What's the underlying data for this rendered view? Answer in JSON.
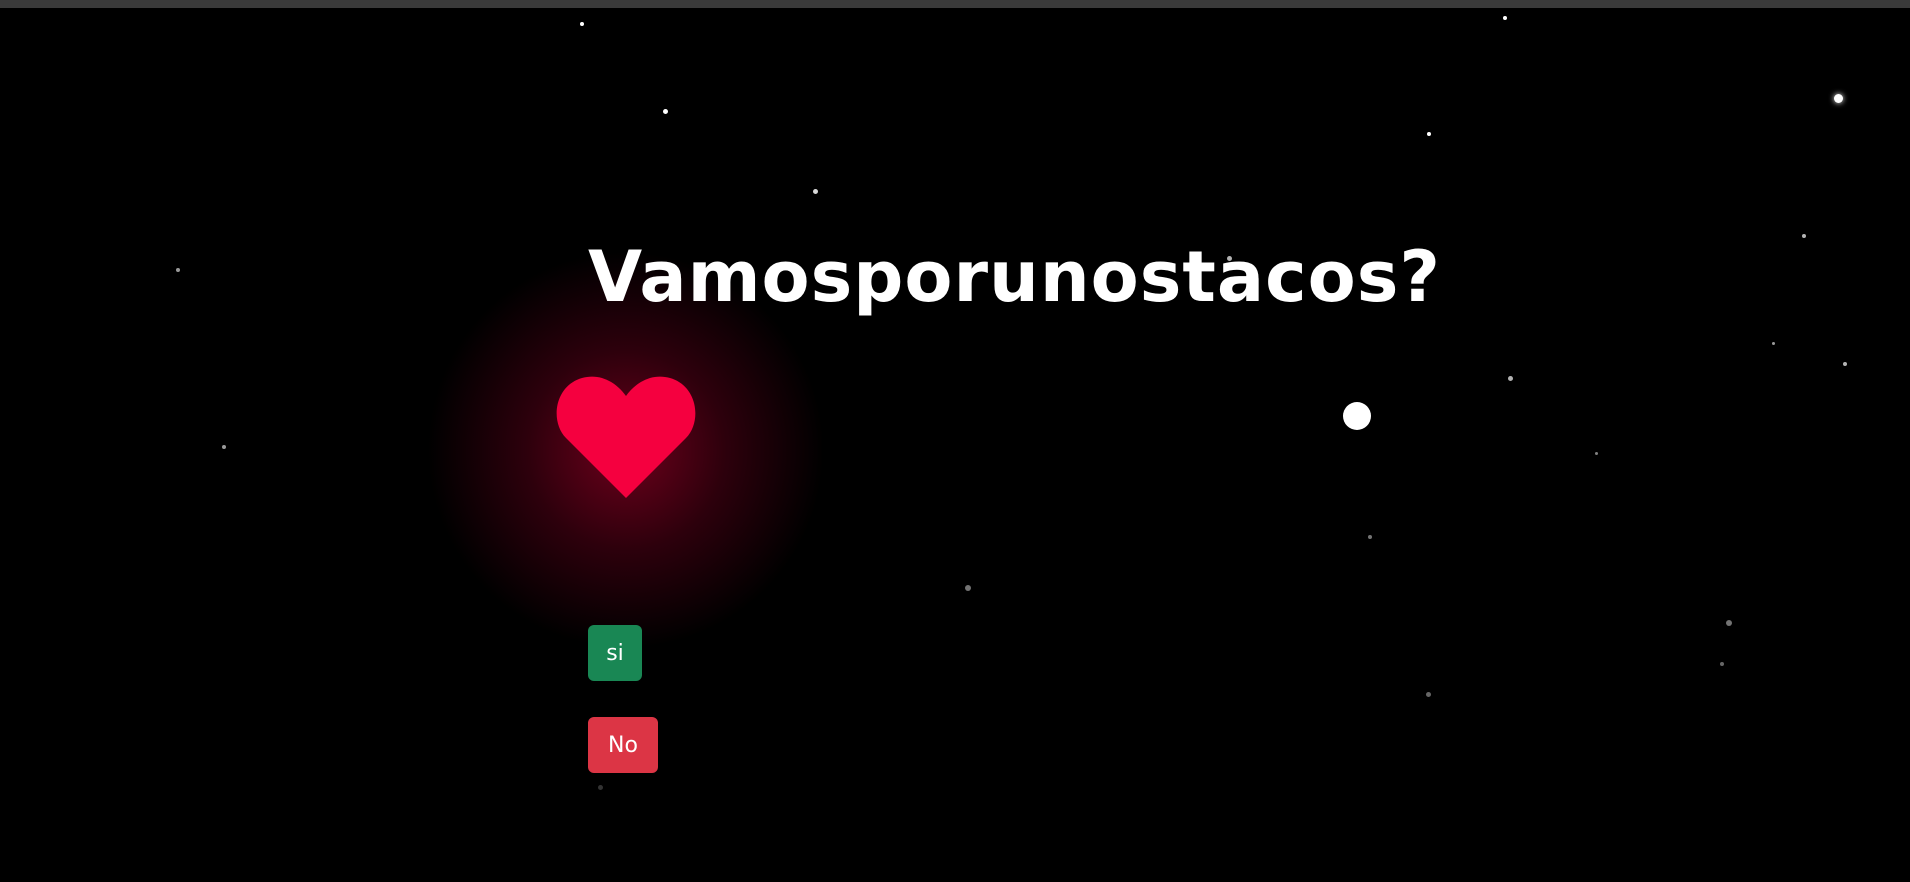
{
  "page": {
    "title": "Vamosporunostacos?",
    "background_color": "#000000"
  },
  "heart": {
    "icon": "heart-icon",
    "color": "#f5003f"
  },
  "buttons": {
    "yes_label": "si",
    "yes_color": "#198754",
    "no_label": "No",
    "no_color": "#dc3545"
  }
}
